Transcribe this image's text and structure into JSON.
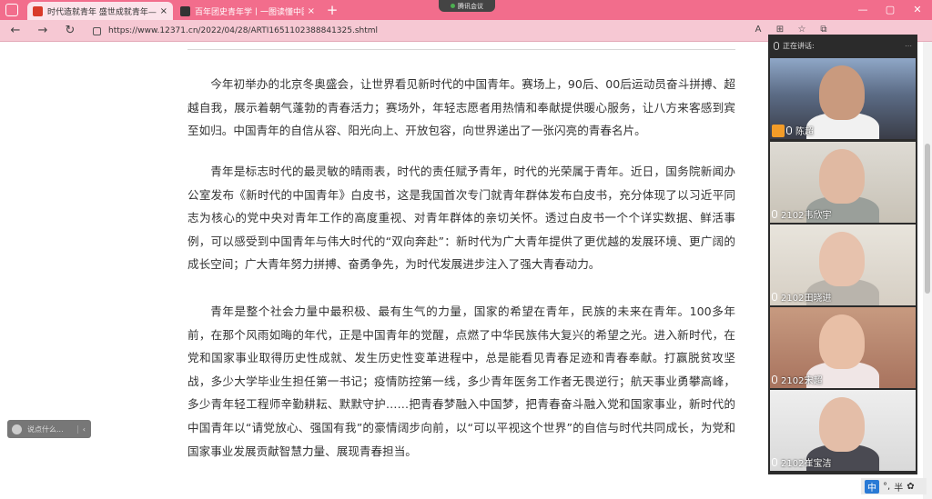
{
  "tabs": [
    {
      "title": "时代造就青年 盛世成就青年——",
      "close": "×"
    },
    {
      "title": "百年团史青年学丨一图读懂中国",
      "close": "×"
    }
  ],
  "new_tab": "+",
  "meeting_pill": "腾讯会议",
  "window_controls": {
    "minimize": "—",
    "maximize": "▢",
    "close": "✕"
  },
  "address": {
    "url": "https://www.12371.cn/2022/04/28/ARTI1651102388841325.shtml"
  },
  "nav": {
    "back": "←",
    "forward": "→",
    "reload": "↻"
  },
  "toolbar_icons": {
    "read_aloud": "A",
    "split": "⊞",
    "favorite": "☆",
    "collections": "⧉"
  },
  "article": {
    "paragraphs": [
      "今年初举办的北京冬奥盛会，让世界看见新时代的中国青年。赛场上，90后、00后运动员奋斗拼搏、超越自我，展示着朝气蓬勃的青春活力；赛场外，年轻志愿者用热情和奉献提供暖心服务，让八方来客感到宾至如归。中国青年的自信从容、阳光向上、开放包容，向世界递出了一张闪亮的青春名片。",
      "青年是标志时代的最灵敏的晴雨表，时代的责任赋予青年，时代的光荣属于青年。近日，国务院新闻办公室发布《新时代的中国青年》白皮书，这是我国首次专门就青年群体发布白皮书，充分体现了以习近平同志为核心的党中央对青年工作的高度重视、对青年群体的亲切关怀。透过白皮书一个个详实数据、鲜活事例，可以感受到中国青年与伟大时代的“双向奔赴”：新时代为广大青年提供了更优越的发展环境、更广阔的成长空间；广大青年努力拼搏、奋勇争先，为时代发展进步注入了强大青春动力。",
      "青年是整个社会力量中最积极、最有生气的力量，国家的希望在青年，民族的未来在青年。100多年前，在那个风雨如晦的年代，正是中国青年的觉醒，点燃了中华民族伟大复兴的希望之光。进入新时代，在党和国家事业取得历史性成就、发生历史性变革进程中，总是能看见青春足迹和青春奉献。打赢脱贫攻坚战，多少大学毕业生担任第一书记；疫情防控第一线，多少青年医务工作者无畏逆行；航天事业勇攀高峰，多少青年轻工程师辛勤耕耘、默默守护……把青春梦融入中国梦，把青春奋斗融入党和国家事业，新时代的中国青年以“请党放心、强国有我”的豪情阔步向前，以“可以平视这个世界”的自信与时代共同成长，为党和国家事业发展贡献智慧力量、展现青春担当。"
    ]
  },
  "comment_bar": {
    "placeholder": "说点什么...",
    "arrow": "‹"
  },
  "meeting": {
    "speaking_label": "正在讲话:",
    "more": "⋯",
    "participants": [
      {
        "name": "陈超",
        "host": true
      },
      {
        "name": "2102韦欣宇",
        "host": false
      },
      {
        "name": "2102田晓进",
        "host": false
      },
      {
        "name": "2102宋超",
        "host": false
      },
      {
        "name": "2102崔宝洁",
        "host": false
      }
    ]
  },
  "ime": {
    "lang": "中",
    "punct": "°,",
    "width": "半",
    "skin": "✿"
  }
}
